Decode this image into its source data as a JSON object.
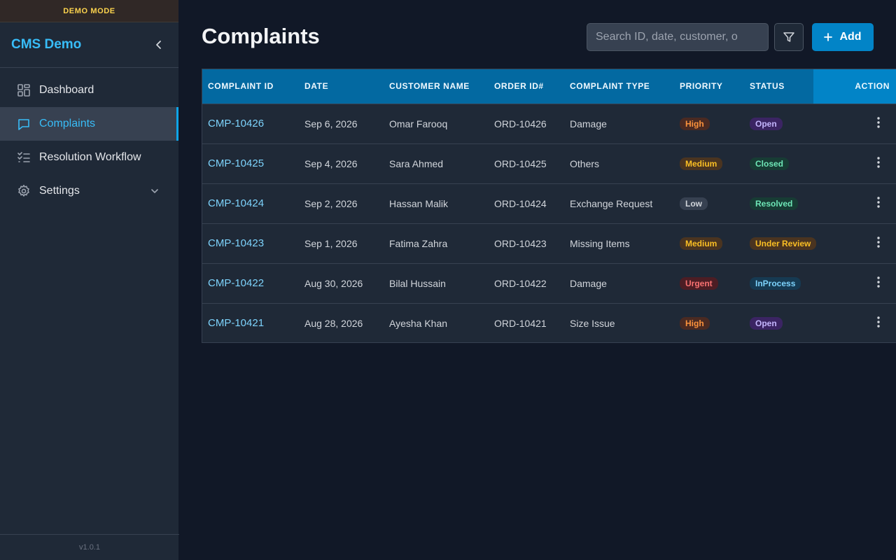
{
  "sidebar": {
    "demo_banner": "DEMO MODE",
    "brand": "CMS Demo",
    "items": [
      {
        "label": "Dashboard",
        "icon": "dashboard-grid-icon",
        "active": false
      },
      {
        "label": "Complaints",
        "icon": "chat-bubble-icon",
        "active": true
      },
      {
        "label": "Resolution Workflow",
        "icon": "checklist-icon",
        "active": false
      },
      {
        "label": "Settings",
        "icon": "gear-icon",
        "active": false
      }
    ],
    "version": "v1.0.1"
  },
  "header": {
    "title": "Complaints",
    "search_placeholder": "Search ID, date, customer, o",
    "add_label": "Add"
  },
  "table": {
    "columns": [
      "COMPLAINT ID",
      "DATE",
      "CUSTOMER NAME",
      "ORDER ID#",
      "COMPLAINT TYPE",
      "PRIORITY",
      "STATUS",
      "ACTION"
    ],
    "rows": [
      {
        "id": "CMP-10426",
        "date": "Sep 6, 2026",
        "customer": "Omar Farooq",
        "order": "ORD-10426",
        "type": "Damage",
        "priority": "High",
        "status": "Open"
      },
      {
        "id": "CMP-10425",
        "date": "Sep 4, 2026",
        "customer": "Sara Ahmed",
        "order": "ORD-10425",
        "type": "Others",
        "priority": "Medium",
        "status": "Closed"
      },
      {
        "id": "CMP-10424",
        "date": "Sep 2, 2026",
        "customer": "Hassan Malik",
        "order": "ORD-10424",
        "type": "Exchange Request",
        "priority": "Low",
        "status": "Resolved"
      },
      {
        "id": "CMP-10423",
        "date": "Sep 1, 2026",
        "customer": "Fatima Zahra",
        "order": "ORD-10423",
        "type": "Missing Items",
        "priority": "Medium",
        "status": "Under Review"
      },
      {
        "id": "CMP-10422",
        "date": "Aug 30, 2026",
        "customer": "Bilal Hussain",
        "order": "ORD-10422",
        "type": "Damage",
        "priority": "Urgent",
        "status": "InProcess"
      },
      {
        "id": "CMP-10421",
        "date": "Aug 28, 2026",
        "customer": "Ayesha Khan",
        "order": "ORD-10421",
        "type": "Size Issue",
        "priority": "High",
        "status": "Open"
      }
    ]
  },
  "colors": {
    "accent": "#0284c7",
    "brand": "#38bdf8",
    "link": "#7dd3fc",
    "priority": {
      "High": {
        "bg": "#4a2a22",
        "fg": "#fb923c"
      },
      "Medium": {
        "bg": "#4a3420",
        "fg": "#fbbf24"
      },
      "Low": {
        "bg": "#374151",
        "fg": "#d1d5db"
      },
      "Urgent": {
        "bg": "#4c1d24",
        "fg": "#f87171"
      }
    },
    "status": {
      "Open": {
        "bg": "#3b2463",
        "fg": "#c4b5fd"
      },
      "Closed": {
        "bg": "#173c34",
        "fg": "#6ee7b7"
      },
      "Resolved": {
        "bg": "#173c34",
        "fg": "#6ee7b7"
      },
      "Under Review": {
        "bg": "#4a3420",
        "fg": "#fbbf24"
      },
      "InProcess": {
        "bg": "#163a52",
        "fg": "#7dd3fc"
      }
    }
  }
}
